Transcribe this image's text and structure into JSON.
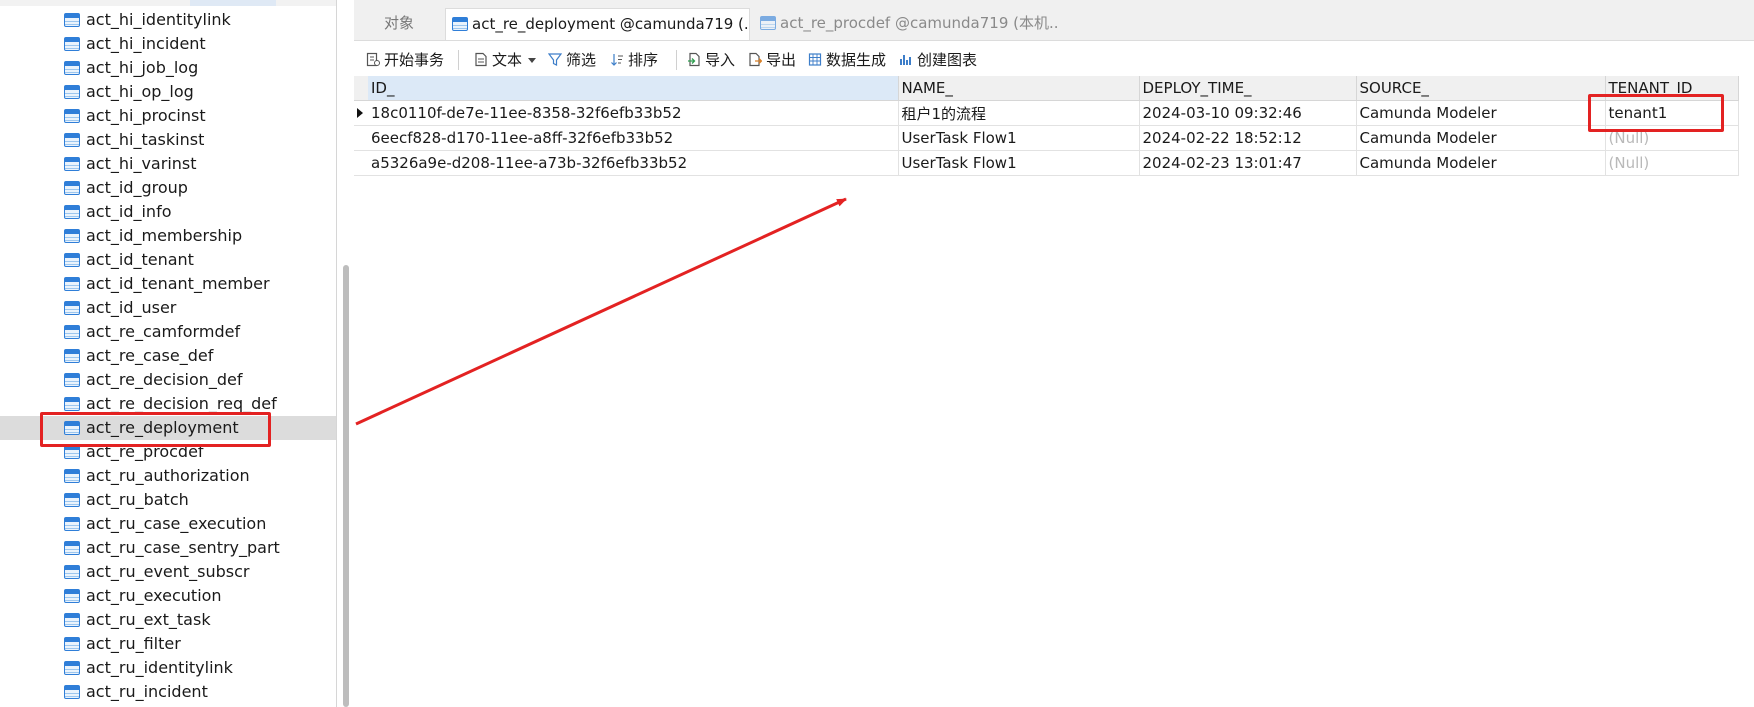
{
  "sidebar": {
    "tables": [
      "act_hi_identitylink",
      "act_hi_incident",
      "act_hi_job_log",
      "act_hi_op_log",
      "act_hi_procinst",
      "act_hi_taskinst",
      "act_hi_varinst",
      "act_id_group",
      "act_id_info",
      "act_id_membership",
      "act_id_tenant",
      "act_id_tenant_member",
      "act_id_user",
      "act_re_camformdef",
      "act_re_case_def",
      "act_re_decision_def",
      "act_re_decision_req_def",
      "act_re_deployment",
      "act_re_procdef",
      "act_ru_authorization",
      "act_ru_batch",
      "act_ru_case_execution",
      "act_ru_case_sentry_part",
      "act_ru_event_subscr",
      "act_ru_execution",
      "act_ru_ext_task",
      "act_ru_filter",
      "act_ru_identitylink",
      "act_ru_incident"
    ],
    "selected": "act_re_deployment"
  },
  "tabs": {
    "objects": "对象",
    "deployment": "act_re_deployment @camunda719 (...",
    "procdef": "act_re_procdef @camunda719 (本机..."
  },
  "toolbar": {
    "begin_transaction": "开始事务",
    "text": "文本",
    "filter": "筛选",
    "sort": "排序",
    "import": "导入",
    "export": "导出",
    "data_generation": "数据生成",
    "create_chart": "创建图表"
  },
  "grid": {
    "columns": [
      "ID_",
      "NAME_",
      "DEPLOY_TIME_",
      "SOURCE_",
      "TENANT_ID_"
    ],
    "rows": [
      {
        "id": "18c0110f-de7e-11ee-8358-32f6efb33b52",
        "name": "租户1的流程",
        "deploy_time": "2024-03-10 09:32:46",
        "source": "Camunda Modeler",
        "tenant_id": "tenant1"
      },
      {
        "id": "6eecf828-d170-11ee-a8ff-32f6efb33b52",
        "name": "UserTask Flow1",
        "deploy_time": "2024-02-22 18:52:12",
        "source": "Camunda Modeler",
        "tenant_id": "(Null)"
      },
      {
        "id": "a5326a9e-d208-11ee-a73b-32f6efb33b52",
        "name": "UserTask Flow1",
        "deploy_time": "2024-02-23 13:01:47",
        "source": "Camunda Modeler",
        "tenant_id": "(Null)"
      }
    ]
  },
  "annotation_color": "#e32222"
}
